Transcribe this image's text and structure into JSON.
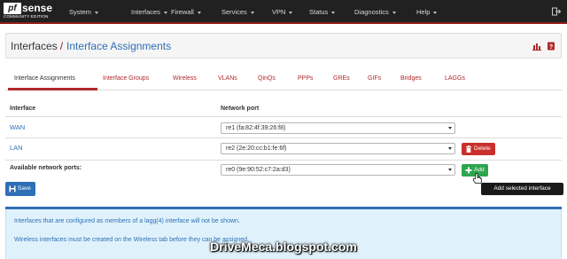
{
  "brand": {
    "logo_text": "pf",
    "name": "sense",
    "edition": "COMMUNITY EDITION"
  },
  "nav": {
    "items": [
      {
        "label": "System"
      },
      {
        "label": "Interfaces"
      },
      {
        "label": "Firewall"
      },
      {
        "label": "Services"
      },
      {
        "label": "VPN"
      },
      {
        "label": "Status"
      },
      {
        "label": "Diagnostics"
      },
      {
        "label": "Help"
      }
    ],
    "logout_icon": "logout-icon"
  },
  "breadcrumb": {
    "section": "Interfaces",
    "separator": "/",
    "page": "Interface Assignments"
  },
  "header_icons": [
    "chart-icon",
    "help-book-icon"
  ],
  "tabs": [
    {
      "label": "Interface Assignments",
      "active": true
    },
    {
      "label": "Interface Groups"
    },
    {
      "label": "Wireless"
    },
    {
      "label": "VLANs"
    },
    {
      "label": "QinQs"
    },
    {
      "label": "PPPs"
    },
    {
      "label": "GREs"
    },
    {
      "label": "GIFs"
    },
    {
      "label": "Bridges"
    },
    {
      "label": "LAGGs"
    }
  ],
  "table": {
    "col_interface": "Interface",
    "col_port": "Network port",
    "rows": [
      {
        "interface": "WAN",
        "port": "re1 (fa:82:4f:39:26:f8)"
      },
      {
        "interface": "LAN",
        "port": "re2 (2e:20:cc:b1:fe:6f)",
        "action": "Delete"
      }
    ],
    "available": {
      "label": "Available network ports:",
      "port": "re0 (9e:90:52:c7:2a:d3)",
      "action": "Add"
    }
  },
  "save_label": "Save",
  "tooltip": "Add selected interface",
  "info": {
    "line1": "Interfaces that are configured as members of a lagg(4) interface will not be shown.",
    "line2": "Wireless interfaces must be created on the Wireless tab before they can be assigned."
  },
  "watermark": "DriveMeca.blogspot.com",
  "colors": {
    "navbar": "#212121",
    "accent_red": "#b0292a",
    "link_blue": "#2f6fb6",
    "delete": "#c9302c",
    "add": "#2ea44f",
    "info_bg": "#dff2fb"
  }
}
